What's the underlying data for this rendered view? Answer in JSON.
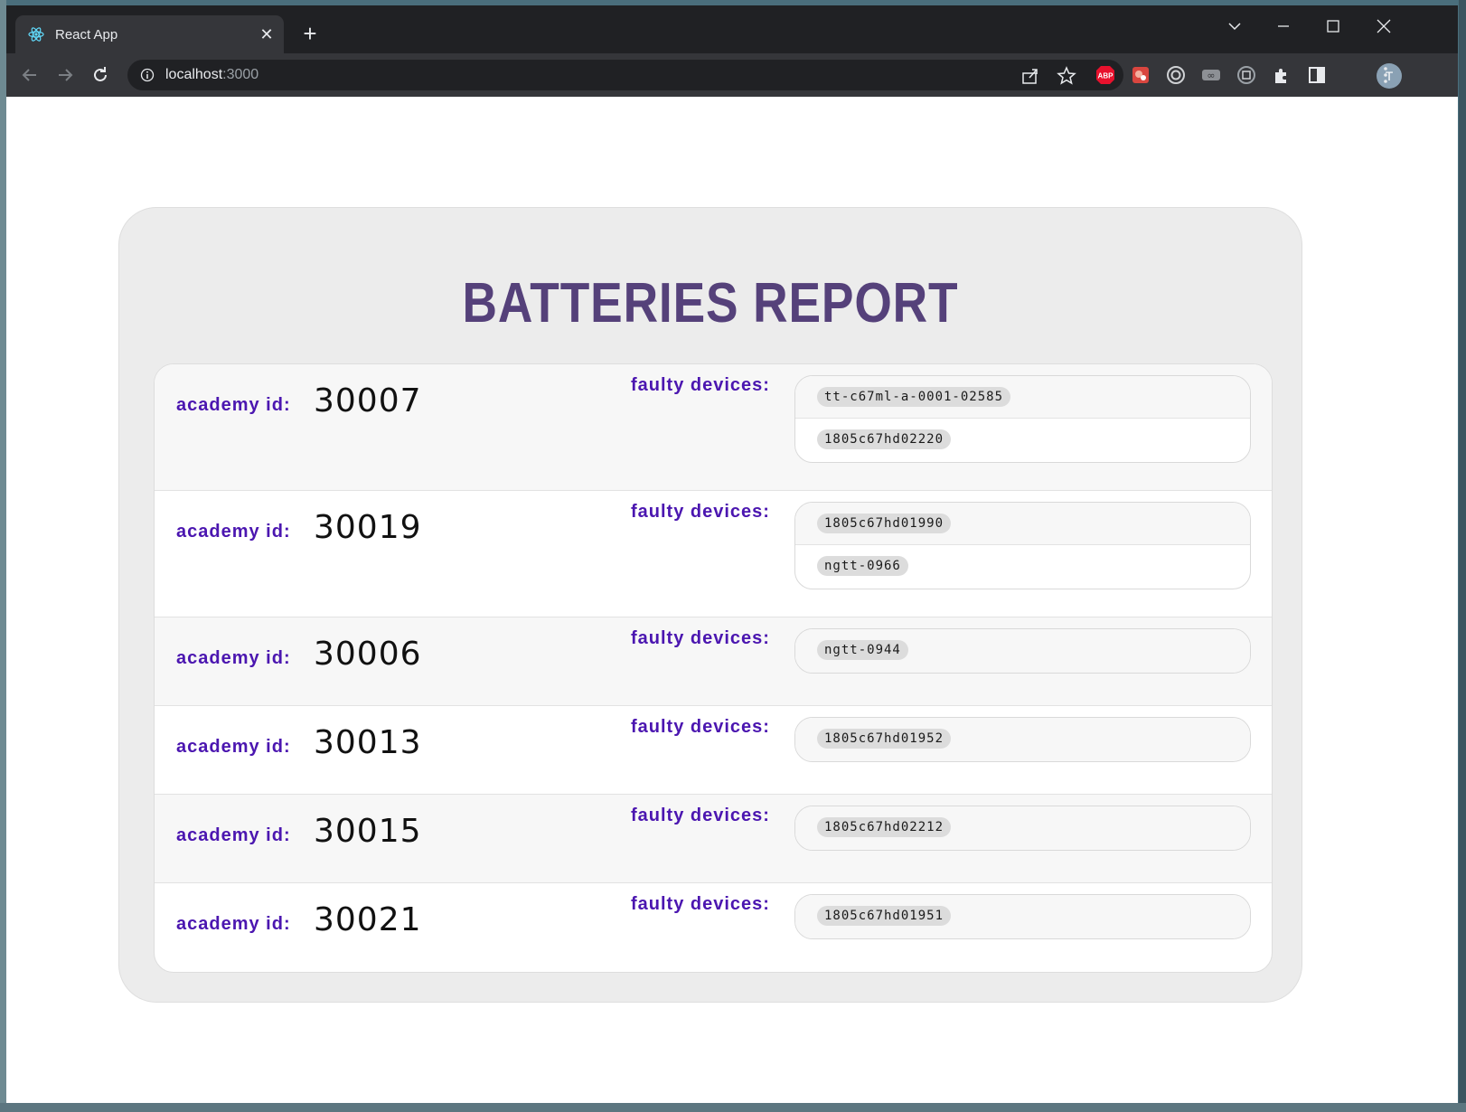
{
  "browser": {
    "tab_title": "React App",
    "url_host": "localhost",
    "url_port": ":3000",
    "avatar_initial": "T",
    "ext_abp_label": "ABP"
  },
  "report": {
    "title": "BATTERIES REPORT",
    "academy_label": "academy id:",
    "faulty_label": "faulty devices:",
    "rows": [
      {
        "academy_id": "30007",
        "devices": [
          "tt-c67ml-a-0001-02585",
          "1805c67hd02220"
        ]
      },
      {
        "academy_id": "30019",
        "devices": [
          "1805c67hd01990",
          "ngtt-0966"
        ]
      },
      {
        "academy_id": "30006",
        "devices": [
          "ngtt-0944"
        ]
      },
      {
        "academy_id": "30013",
        "devices": [
          "1805c67hd01952"
        ]
      },
      {
        "academy_id": "30015",
        "devices": [
          "1805c67hd02212"
        ]
      },
      {
        "academy_id": "30021",
        "devices": [
          "1805c67hd01951"
        ]
      }
    ]
  },
  "colors": {
    "title": "#55417a",
    "label": "#4b16b0",
    "card_bg": "#ececec",
    "chip_bg": "#dcdcdc"
  },
  "icons": [
    "react-icon",
    "close-icon",
    "plus-icon",
    "chevron-down-icon",
    "minimize-icon",
    "maximize-icon",
    "back-icon",
    "forward-icon",
    "reload-icon",
    "info-icon",
    "share-icon",
    "star-icon",
    "extensions-icon",
    "sidepanel-icon",
    "kebab-menu-icon"
  ]
}
